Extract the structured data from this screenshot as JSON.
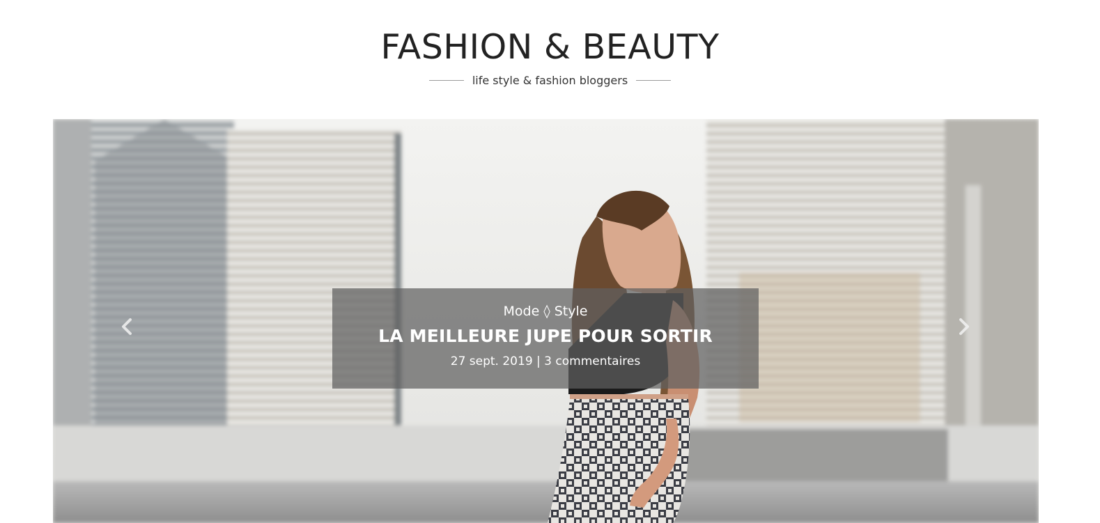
{
  "header": {
    "title": "FASHION & BEAUTY",
    "tagline": "life style & fashion bloggers"
  },
  "slider": {
    "slide": {
      "category": "Mode ◊ Style",
      "title": "LA MEILLEURE JUPE POUR SORTIR",
      "meta": "27 sept. 2019 | 3 commentaires"
    },
    "prev_icon": "chevron-left-icon",
    "next_icon": "chevron-right-icon"
  },
  "colors": {
    "caption_bg": "#5f5f5f",
    "text_dark": "#222222",
    "caption_text": "#ffffff"
  }
}
